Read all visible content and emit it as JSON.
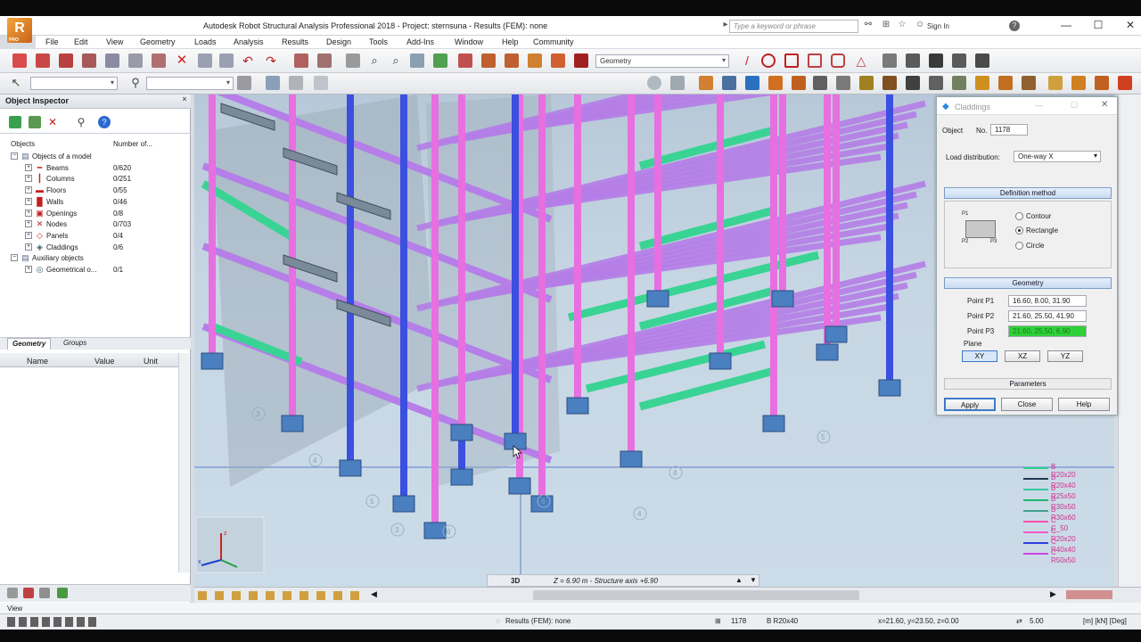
{
  "window": {
    "title": "Autodesk Robot Structural Analysis Professional 2018 - Project: sternsuna - Results (FEM): none",
    "search_placeholder": "Type a keyword or phrase",
    "sign_in": "Sign In",
    "help": "?",
    "logo_text": "R",
    "logo_sub": "PRO",
    "minimize": "—",
    "maximize": "☐",
    "close": "✕"
  },
  "menu": [
    "File",
    "Edit",
    "View",
    "Geometry",
    "Loads",
    "Analysis",
    "Results",
    "Design",
    "Tools",
    "Add-Ins",
    "Window",
    "Help",
    "Community"
  ],
  "toolbar": {
    "layout_combo": "Geometry"
  },
  "inspector": {
    "title": "Object Inspector",
    "close": "×",
    "col_objects": "Objects",
    "col_number": "Number of...",
    "tree": [
      {
        "label": "Objects of a model",
        "count": "",
        "level": 0,
        "icon": "folder-icon",
        "color": "#5a6a8a"
      },
      {
        "label": "Beams",
        "count": "0/620",
        "level": 1,
        "icon": "beam-icon",
        "color": "#c02020"
      },
      {
        "label": "Columns",
        "count": "0/251",
        "level": 1,
        "icon": "column-icon",
        "color": "#c02020"
      },
      {
        "label": "Floors",
        "count": "0/55",
        "level": 1,
        "icon": "floor-icon",
        "color": "#c02020"
      },
      {
        "label": "Walls",
        "count": "0/46",
        "level": 1,
        "icon": "wall-icon",
        "color": "#c02020"
      },
      {
        "label": "Openings",
        "count": "0/8",
        "level": 1,
        "icon": "opening-icon",
        "color": "#c02020"
      },
      {
        "label": "Nodes",
        "count": "0/703",
        "level": 1,
        "icon": "node-icon",
        "color": "#c02020"
      },
      {
        "label": "Panels",
        "count": "0/4",
        "level": 1,
        "icon": "panel-icon",
        "color": "#c02020"
      },
      {
        "label": "Claddings",
        "count": "0/6",
        "level": 1,
        "icon": "cladding-icon",
        "color": "#406070"
      },
      {
        "label": "Auxiliary objects",
        "count": "",
        "level": 0,
        "icon": "folder-icon",
        "color": "#5a6a8a"
      },
      {
        "label": "Geometrical o...",
        "count": "0/1",
        "level": 1,
        "icon": "geometry-icon",
        "color": "#406070"
      }
    ],
    "tab_geometry": "Geometry",
    "tab_groups": "Groups",
    "prop_name": "Name",
    "prop_value": "Value",
    "prop_unit": "Unit"
  },
  "dialog": {
    "title": "Claddings",
    "object_label": "Object",
    "no_label": "No.",
    "no_value": "1178",
    "load_distribution_label": "Load distribution:",
    "load_distribution_value": "One-way X",
    "definition_method": "Definition method",
    "p1": "P1",
    "p2": "P2",
    "p3": "P3",
    "opt_contour": "Contour",
    "opt_rectangle": "Rectangle",
    "opt_circle": "Circle",
    "geometry": "Geometry",
    "point_p1_label": "Point P1",
    "point_p1_value": "16.60, 8.00, 31.90",
    "point_p2_label": "Point P2",
    "point_p2_value": "21.60, 25.50, 41.90",
    "point_p3_label": "Point P3",
    "point_p3_value": "21.60, 25.50, 6.90",
    "plane_label": "Plane",
    "plane_xy": "XY",
    "plane_xz": "XZ",
    "plane_yz": "YZ",
    "parameters": "Parameters",
    "apply": "Apply",
    "close": "Close",
    "help": "Help",
    "highlight_color": "#2fcf3a"
  },
  "viewport": {
    "mode": "3D",
    "readout": "Z = 6.90 m - Structure axis +6.90",
    "legend": [
      {
        "label": "B R20x20",
        "color": "#2fd18a"
      },
      {
        "label": "B R20x40",
        "color": "#203a50"
      },
      {
        "label": "B R25x50",
        "color": "#38c7a0"
      },
      {
        "label": "B R30x50",
        "color": "#1db86a"
      },
      {
        "label": "B R30x60",
        "color": "#40a090"
      },
      {
        "label": "C C_50",
        "color": "#ff4fb0"
      },
      {
        "label": "C R20x20",
        "color": "#ee5ac8"
      },
      {
        "label": "C R40x40",
        "color": "#3040e0"
      },
      {
        "label": "C R50x50",
        "color": "#d040e0"
      }
    ],
    "axis_labels": [
      "3",
      "4",
      "5",
      "6",
      "4",
      "5",
      "6",
      "3",
      "4"
    ],
    "axis_x": "x",
    "axis_z": "z"
  },
  "status": {
    "view": "View",
    "results": "Results (FEM): none",
    "node_no": "1178",
    "section": "B R20x40",
    "coords": "x=21.60, y=23.50, z=0.00",
    "value": "5.00",
    "units": "[m] [kN] [Deg]"
  },
  "colors": {
    "column_pink": "#e86fe0",
    "column_blue": "#3b4fe0",
    "beam_violet": "#b57ee8",
    "beam_green": "#39d494",
    "slab_gray": "#9aa8b4",
    "footing_blue": "#4a7fc0"
  }
}
